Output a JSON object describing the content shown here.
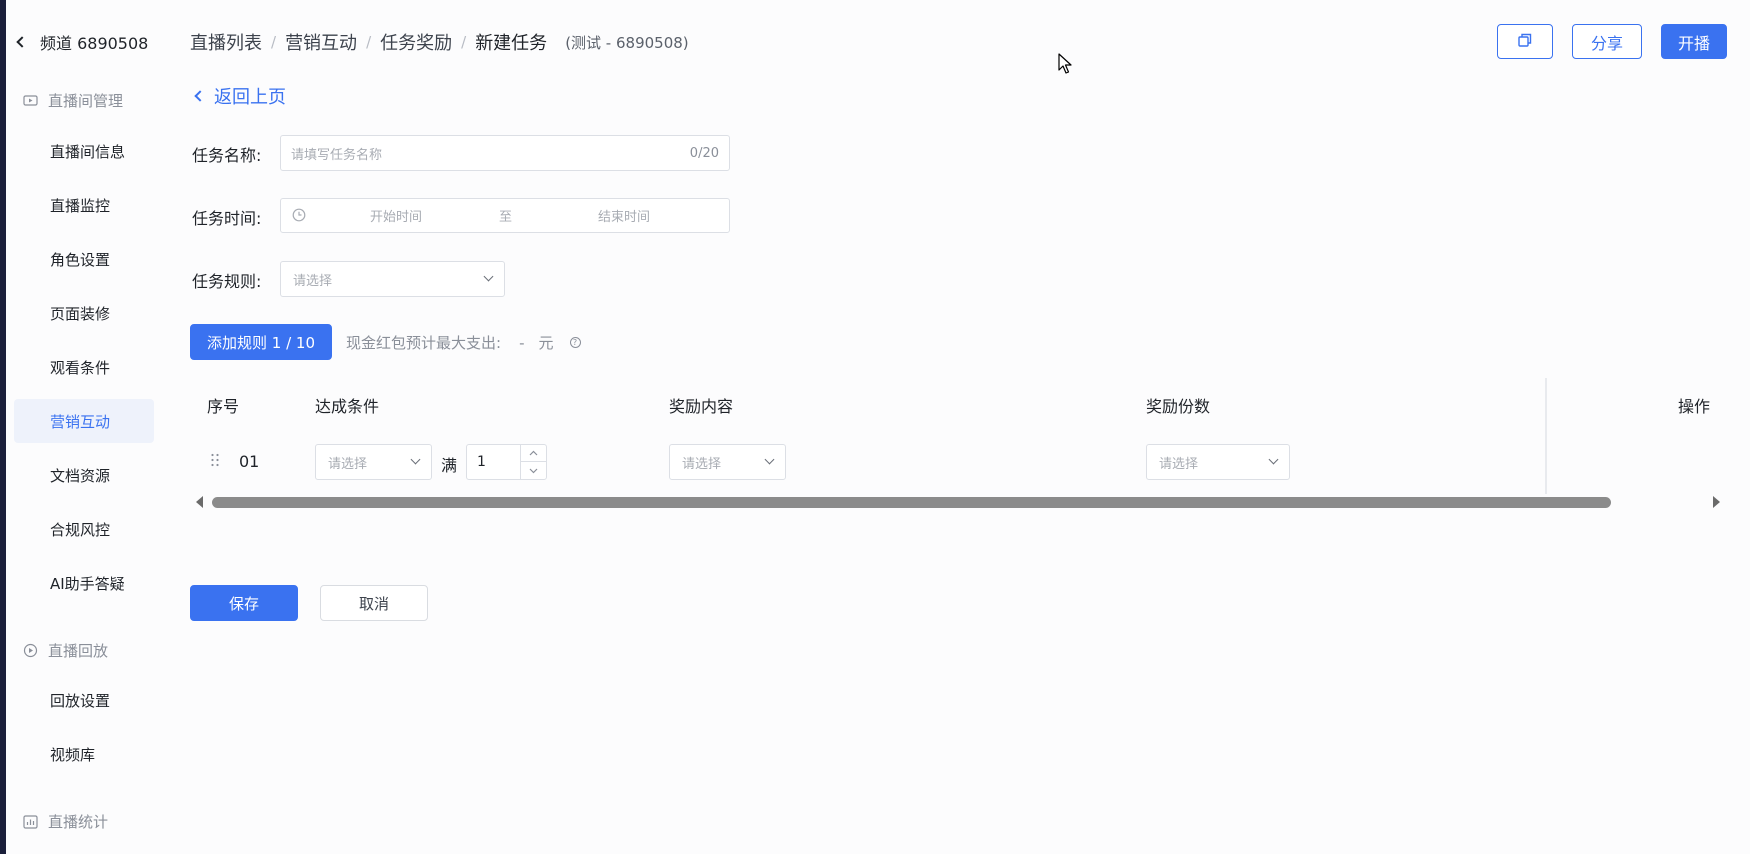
{
  "sidebar": {
    "channel": "频道 6890508",
    "groups": [
      {
        "title": "直播间管理",
        "icon": "live-room-icon"
      },
      {
        "title": "直播回放",
        "icon": "replay-icon"
      },
      {
        "title": "直播统计",
        "icon": "stats-icon"
      }
    ],
    "items": [
      {
        "label": "直播间信息"
      },
      {
        "label": "直播监控"
      },
      {
        "label": "角色设置"
      },
      {
        "label": "页面装修"
      },
      {
        "label": "观看条件"
      },
      {
        "label": "营销互动",
        "active": true
      },
      {
        "label": "文档资源"
      },
      {
        "label": "合规风控"
      },
      {
        "label": "AI助手答疑"
      },
      {
        "label": "回放设置"
      },
      {
        "label": "视频库"
      }
    ]
  },
  "header": {
    "breadcrumb": [
      "直播列表",
      "营销互动",
      "任务奖励",
      "新建任务"
    ],
    "separator": "/",
    "suffix": "(测试 - 6890508)",
    "share_label": "分享",
    "start_label": "开播"
  },
  "back_label": "返回上页",
  "form": {
    "name_label": "任务名称:",
    "name_placeholder": "请填写任务名称",
    "name_count": "0/20",
    "time_label": "任务时间:",
    "time_start": "开始时间",
    "time_to": "至",
    "time_end": "结束时间",
    "rule_label": "任务规则:",
    "rule_placeholder": "请选择"
  },
  "rules": {
    "add_label": "添加规则 1 / 10",
    "hint": "现金红包预计最大支出:",
    "hint_value": "-",
    "hint_unit": "元",
    "hint_icon": "?"
  },
  "table": {
    "headers": [
      "序号",
      "达成条件",
      "奖励内容",
      "奖励份数",
      "操作"
    ],
    "row": {
      "index": "01",
      "condition_placeholder": "请选择",
      "full_label": "满",
      "full_value": "1",
      "reward_placeholder": "请选择",
      "count_placeholder": "请选择"
    }
  },
  "footer": {
    "save_label": "保存",
    "cancel_label": "取消"
  },
  "colors": {
    "accent": "#3a72f0",
    "active_bg": "#eef2fb"
  }
}
